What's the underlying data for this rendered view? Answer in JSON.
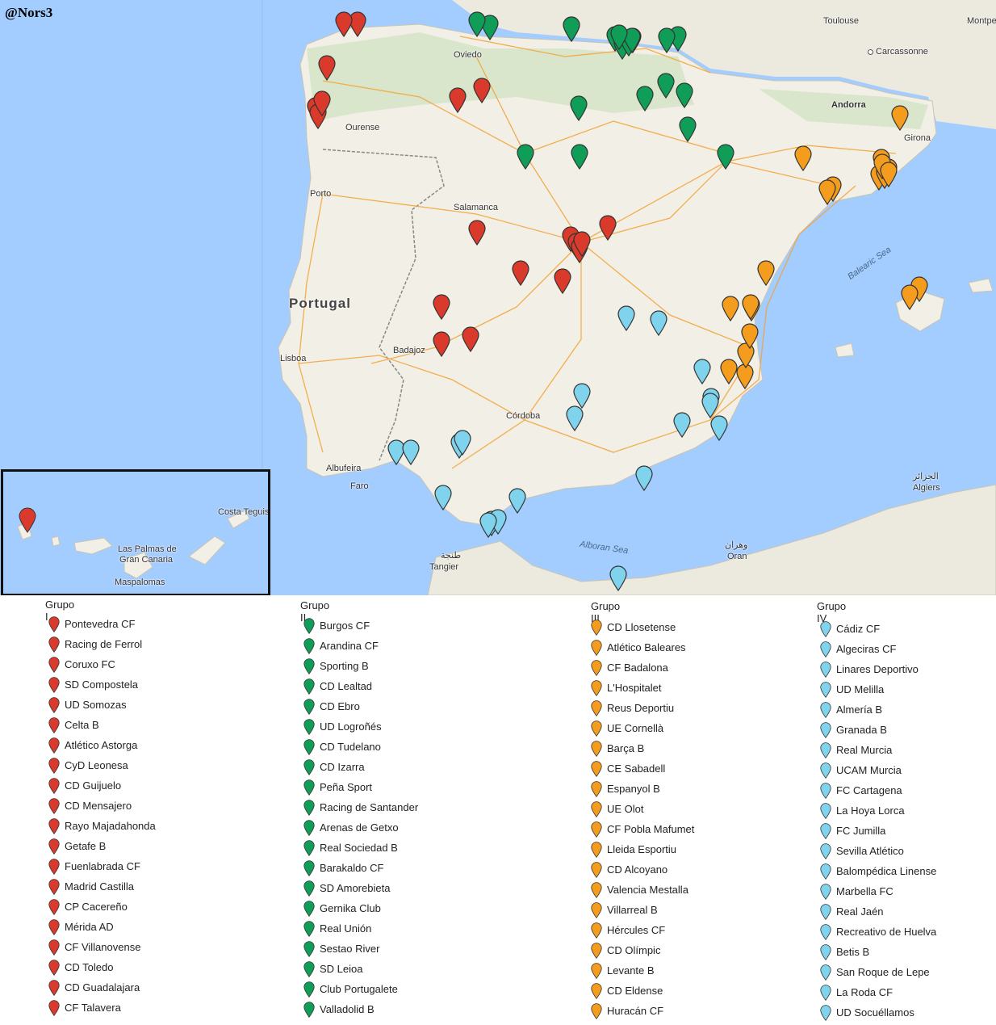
{
  "credit": "@Nors3",
  "colors": {
    "grupo1": "#d93a2b",
    "grupo2": "#0f9d58",
    "grupo3": "#f39c1e",
    "grupo4": "#7fd3ec",
    "sea": "#a3ccff",
    "land": "#f2efe6",
    "road": "#f4a233"
  },
  "map": {
    "country_label": "Portugal",
    "cities": [
      "Toulouse",
      "Carcassonne",
      "Montpellier",
      "Andorra",
      "Girona",
      "Oviedo",
      "Ourense",
      "Porto",
      "Salamanca",
      "Lisboa",
      "Badajoz",
      "Córdoba",
      "Albufeira",
      "Faro",
      "Tangier",
      "طنجة",
      "Oran",
      "وهران",
      "Algiers",
      "الجزائر"
    ],
    "seas": [
      "Balearic Sea",
      "Alboran Sea"
    ],
    "inset_cities": [
      "Costa Teguise",
      "Las Palmas de",
      "Gran Canaria",
      "Maspalomas"
    ]
  },
  "legend": {
    "groups": [
      {
        "title": "Grupo I",
        "color": "#d93a2b",
        "teams": [
          "Pontevedra CF",
          "Racing de Ferrol",
          "Coruxo FC",
          "SD Compostela",
          "UD Somozas",
          "Celta B",
          "Atlético Astorga",
          "CyD Leonesa",
          "CD Guijuelo",
          "CD Mensajero",
          "Rayo Majadahonda",
          "Getafe B",
          "Fuenlabrada CF",
          "Madrid Castilla",
          "CP Cacereño",
          "Mérida AD",
          "CF Villanovense",
          "CD Toledo",
          "CD Guadalajara",
          "CF Talavera"
        ]
      },
      {
        "title": "Grupo II",
        "color": "#0f9d58",
        "teams": [
          "Burgos CF",
          "Arandina CF",
          "Sporting B",
          "CD Lealtad",
          "CD Ebro",
          "UD Logroñés",
          "CD Tudelano",
          "CD Izarra",
          "Peña Sport",
          "Racing de Santander",
          "Arenas de Getxo",
          "Real Sociedad B",
          "Barakaldo CF",
          "SD Amorebieta",
          "Gernika Club",
          "Real Unión",
          "Sestao River",
          "SD Leioa",
          "Club Portugalete",
          "Valladolid B"
        ]
      },
      {
        "title": "Grupo III",
        "color": "#f39c1e",
        "teams": [
          "CD Llosetense",
          "Atlético Baleares",
          "CF Badalona",
          "L'Hospitalet",
          "Reus Deportiu",
          "UE Cornellà",
          "Barça B",
          "CE Sabadell",
          "Espanyol B",
          "UE Olot",
          "CF Pobla Mafumet",
          "Lleida Esportiu",
          "CD Alcoyano",
          "Valencia Mestalla",
          "Villarreal B",
          "Hércules CF",
          "CD Olímpic",
          "Levante B",
          "CD Eldense",
          "Huracán CF"
        ]
      },
      {
        "title": "Grupo IV",
        "color": "#7fd3ec",
        "teams": [
          "Cádiz CF",
          "Algeciras CF",
          "Linares Deportivo",
          "UD Melilla",
          "Almería B",
          "Granada B",
          "Real Murcia",
          "UCAM Murcia",
          "FC Cartagena",
          "La Hoya Lorca",
          "FC Jumilla",
          "Sevilla Atlético",
          "Balompédica Linense",
          "Marbella FC",
          "Real Jaén",
          "Recreativo de Huelva",
          "Betis B",
          "San Roque de Lepe",
          "La Roda CF",
          "UD Socuéllamos"
        ]
      }
    ]
  }
}
